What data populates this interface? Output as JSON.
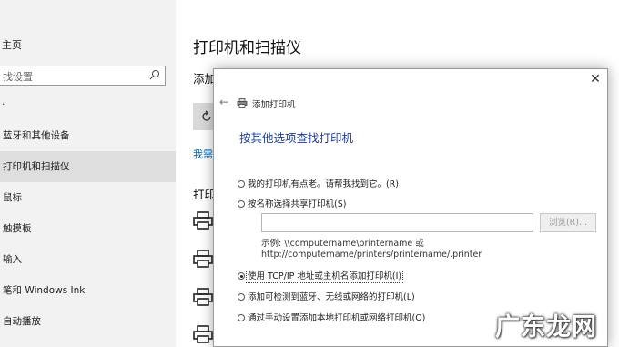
{
  "sidebar": {
    "home": "主页",
    "search_placeholder": "找设置",
    "section_head": "·",
    "items": [
      {
        "label": "蓝牙和其他设备"
      },
      {
        "label": "打印机和扫描仪"
      },
      {
        "label": "鼠标"
      },
      {
        "label": "触摸板"
      },
      {
        "label": "输入"
      },
      {
        "label": "笔和 Windows Ink"
      },
      {
        "label": "自动播放"
      }
    ]
  },
  "main": {
    "title": "打印机和扫描仪",
    "add_heading": "添加打印机和扫描仪",
    "need_link": "我需",
    "printers_heading": "打印"
  },
  "dialog": {
    "title": "添加打印机",
    "heading": "按其他选项查找打印机",
    "options": [
      {
        "label": "我的打印机有点老。请帮我找到它。(R)",
        "selected": false
      },
      {
        "label": "按名称选择共享打印机(S)",
        "selected": false
      },
      {
        "label": "使用 TCP/IP 地址或主机名添加打印机(I)",
        "selected": true
      },
      {
        "label": "添加可检测到蓝牙、无线或网络的打印机(L)",
        "selected": false
      },
      {
        "label": "通过手动设置添加本地打印机或网络打印机(O)",
        "selected": false
      }
    ],
    "share_value": "",
    "browse_label": "浏览(R)...",
    "example_line1": "示例: \\\\computername\\printername 或",
    "example_line2": "http://computername/printers/printername/.printer"
  },
  "watermark": "广东龙网",
  "icons": {
    "search": "search-icon",
    "refresh": "refresh-icon",
    "printer": "printer-icon",
    "close": "close-icon",
    "back": "back-arrow-icon"
  }
}
